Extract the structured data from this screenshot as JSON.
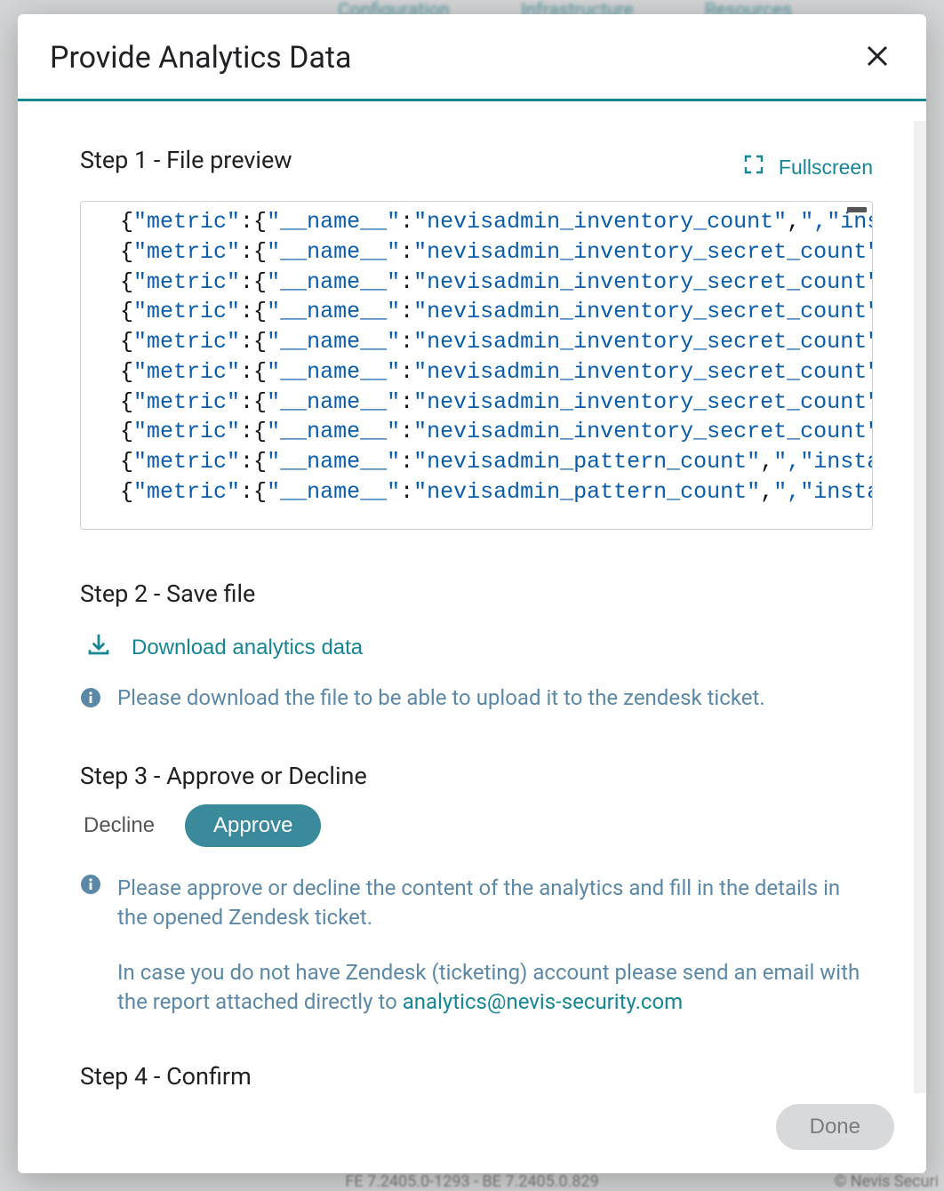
{
  "background": {
    "nav": [
      "Configuration",
      "Infrastructure",
      "Resources"
    ],
    "footer_version": "FE 7.2405.0-1293 - BE 7.2405.0.829",
    "footer_right": "© Nevis Securi"
  },
  "modal": {
    "title": "Provide Analytics Data",
    "fullscreen_label": "Fullscreen",
    "step1": {
      "title": "Step 1 - File preview",
      "code_lines": [
        {
          "prefix": "{\"metric\":{\"__name__\":\"",
          "value": "nevisadmin_inventory_count",
          "suffix": "\",\"instanc"
        },
        {
          "prefix": "{\"metric\":{\"__name__\":\"",
          "value": "nevisadmin_inventory_secret_count",
          "suffix": "\",\""
        },
        {
          "prefix": "{\"metric\":{\"__name__\":\"",
          "value": "nevisadmin_inventory_secret_count",
          "suffix": "\",\""
        },
        {
          "prefix": "{\"metric\":{\"__name__\":\"",
          "value": "nevisadmin_inventory_secret_count",
          "suffix": "\",\""
        },
        {
          "prefix": "{\"metric\":{\"__name__\":\"",
          "value": "nevisadmin_inventory_secret_count",
          "suffix": "\",\""
        },
        {
          "prefix": "{\"metric\":{\"__name__\":\"",
          "value": "nevisadmin_inventory_secret_count",
          "suffix": "\",\""
        },
        {
          "prefix": "{\"metric\":{\"__name__\":\"",
          "value": "nevisadmin_inventory_secret_count",
          "suffix": "\",\""
        },
        {
          "prefix": "{\"metric\":{\"__name__\":\"",
          "value": "nevisadmin_inventory_secret_count",
          "suffix": "\",\""
        },
        {
          "prefix": "{\"metric\":{\"__name__\":\"",
          "value": "nevisadmin_pattern_count",
          "suffix": "\",\"instance\""
        },
        {
          "prefix": "{\"metric\":{\"__name__\":\"",
          "value": "nevisadmin_pattern_count",
          "suffix": "\",\"instance\""
        }
      ]
    },
    "step2": {
      "title": "Step 2 - Save file",
      "download_label": "Download analytics data",
      "info": "Please download the file to be able to upload it to the zendesk ticket."
    },
    "step3": {
      "title": "Step 3 - Approve or Decline",
      "decline_label": "Decline",
      "approve_label": "Approve",
      "info_p1": "Please approve or decline the content of the analytics and fill in the details in the opened Zendesk ticket.",
      "info_p2_prefix": "In case you do not have Zendesk (ticketing) account please send an email with the report attached directly to ",
      "info_email": "analytics@nevis-security.com"
    },
    "step4": {
      "title": "Step 4 - Confirm"
    },
    "footer": {
      "done_label": "Done"
    }
  }
}
